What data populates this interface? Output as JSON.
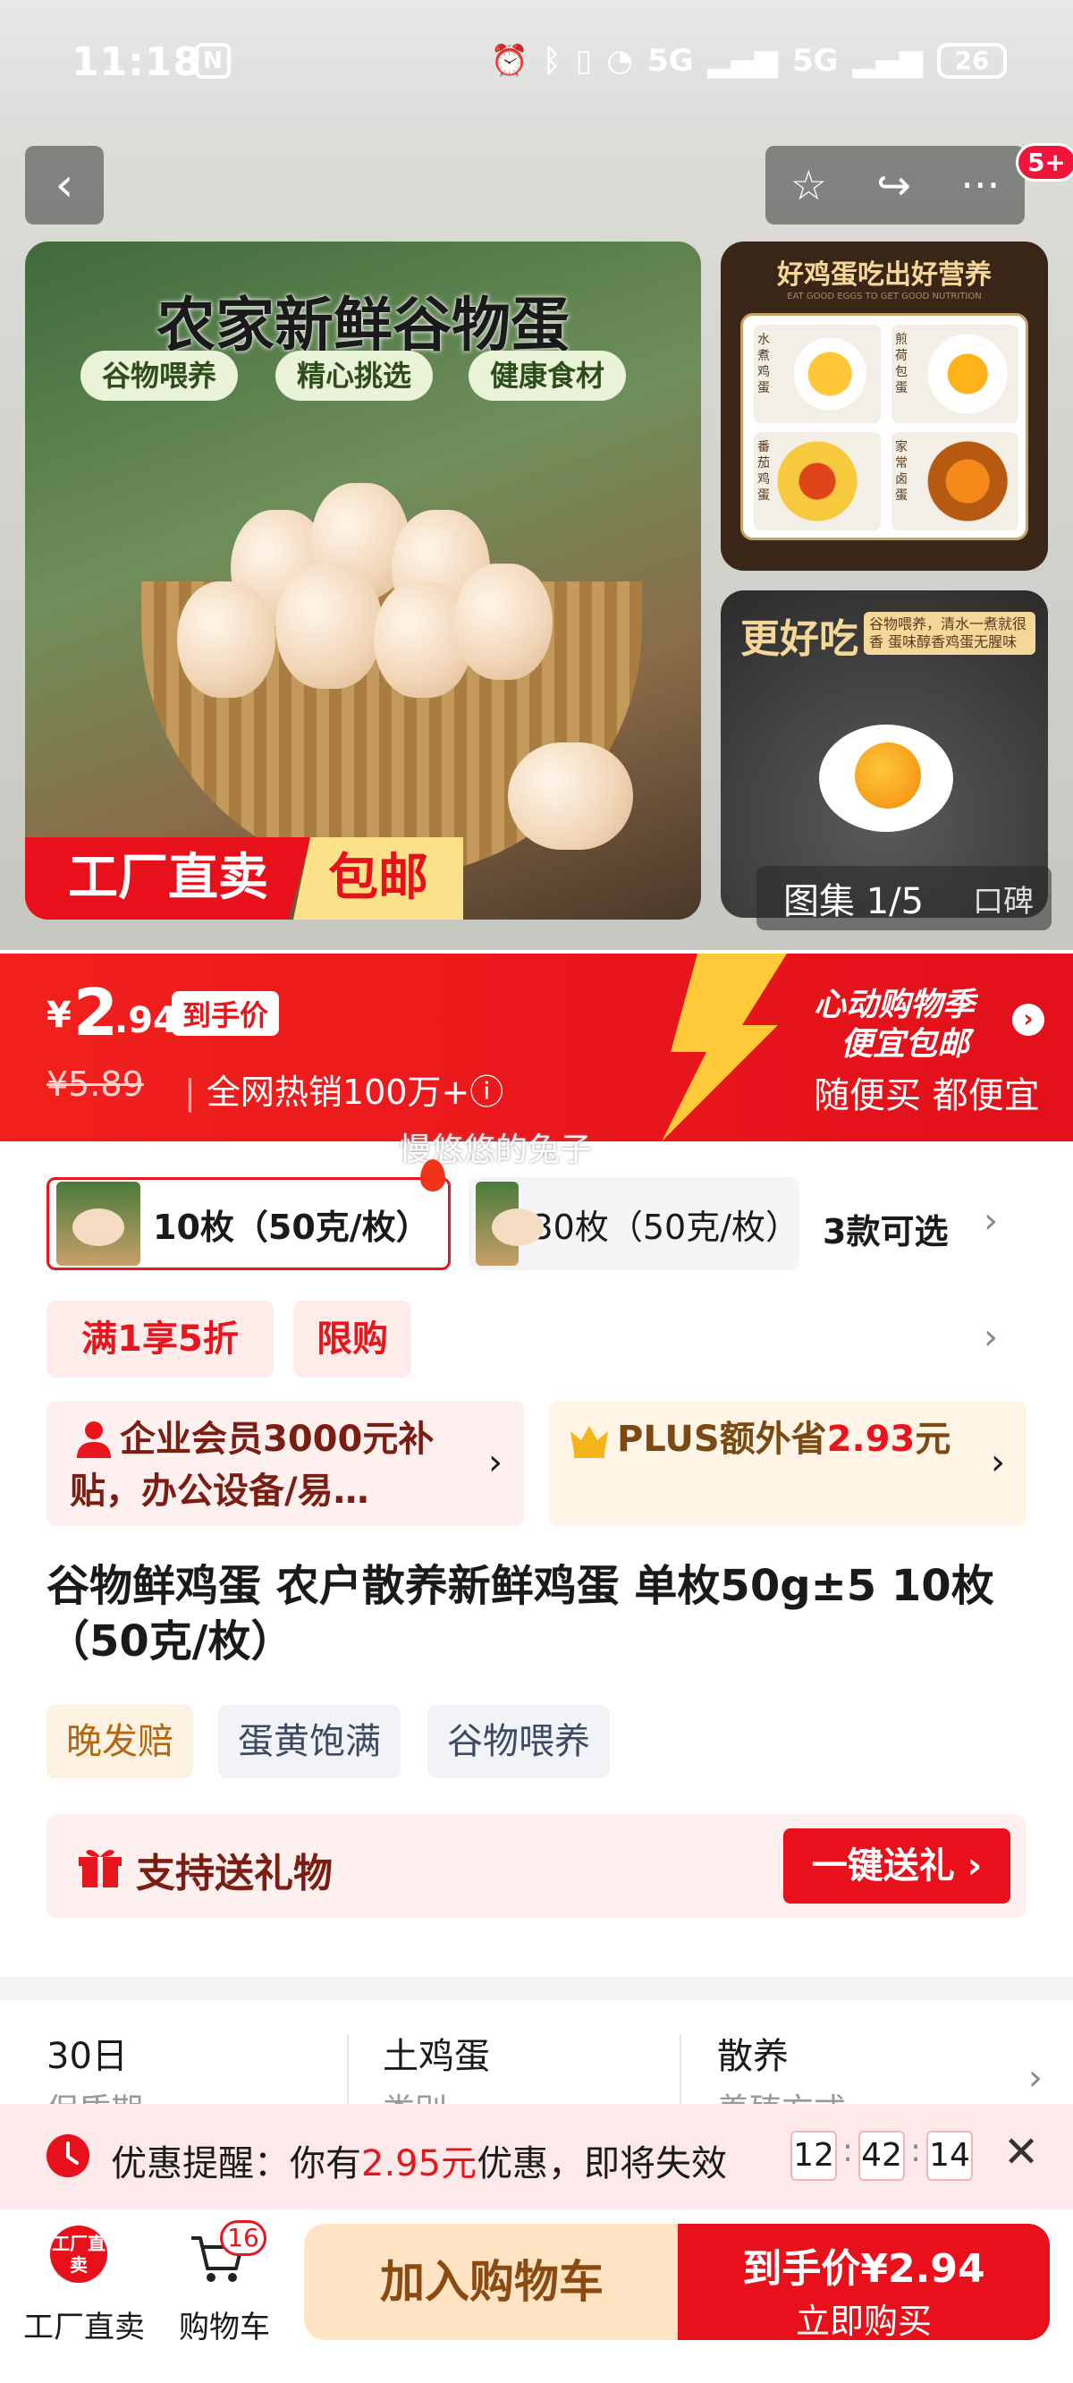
{
  "status_bar": {
    "time": "11:18",
    "nfc": "N",
    "network": "5G",
    "network2": "5G",
    "battery": "26"
  },
  "header": {
    "back_icon": "‹",
    "favorite_icon": "☆",
    "share_icon": "↪",
    "more_icon": "···",
    "badge": "5+"
  },
  "gallery": {
    "main_title": "农家新鲜谷物蛋",
    "main_tags": [
      "谷物喂养",
      "精心挑选",
      "健康食材"
    ],
    "ribbon_left": "工厂直卖",
    "ribbon_right": "包邮",
    "side1_title": "好鸡蛋吃出好营养",
    "side1_sub": "EAT GOOD EGGS TO GET GOOD NUTRITION",
    "side1_items": [
      "水煮鸡蛋",
      "煎荷包蛋",
      "番茄鸡蛋",
      "家常卤蛋"
    ],
    "side2_title": "更好吃",
    "side2_note": "谷物喂养，清水一煮就很香 蛋味醇香鸡蛋无腥味",
    "counter_label": "图集 1/5",
    "review_label": "口碑"
  },
  "price": {
    "currency": "¥",
    "integer": "2",
    "decimal": ".94",
    "tag": "到手价",
    "original": "¥5.89",
    "sold": "全网热销100万+ⓘ",
    "promo_title": "心动购物季",
    "promo_sub": "便宜包邮",
    "promo_slogan": "随便买 都便宜"
  },
  "watermark": "慢悠悠的兔子",
  "variants": {
    "items": [
      "10枚（50克/枚）",
      "30枚（50克/枚）"
    ],
    "count": "3款可选"
  },
  "promos": {
    "chips": [
      "满1享5折",
      "限购"
    ]
  },
  "cards": {
    "biz": "企业会员3000元补贴，办公设备/易…",
    "plus_prefix": "PLUS额外省",
    "plus_amount": "2.93",
    "plus_suffix": "元"
  },
  "product": {
    "title": "谷物鲜鸡蛋 农户散养新鲜鸡蛋 单枚50g±5 10枚（50克/枚）",
    "tags": [
      "晚发赔",
      "蛋黄饱满",
      "谷物喂养"
    ]
  },
  "gift": {
    "text": "支持送礼物",
    "button": "一键送礼 ›"
  },
  "specs": [
    {
      "value": "30日",
      "label": "保质期"
    },
    {
      "value": "土鸡蛋",
      "label": "类别"
    },
    {
      "value": "散养",
      "label": "养殖方式"
    }
  ],
  "reminder": {
    "prefix": "优惠提醒：你有",
    "amount": "2.95元",
    "suffix": "优惠，即将失效",
    "hh": "12",
    "mm": "42",
    "ss": "14"
  },
  "bottom": {
    "factory_icon_text": "工厂直卖",
    "factory_label": "工厂直卖",
    "cart_count": "16",
    "cart_label": "购物车",
    "add_cart": "加入购物车",
    "buy_top": "到手价¥2.94",
    "buy_bottom": "立即购买"
  },
  "colors": {
    "accent": "#e8101a",
    "plus": "#7a4a12"
  }
}
